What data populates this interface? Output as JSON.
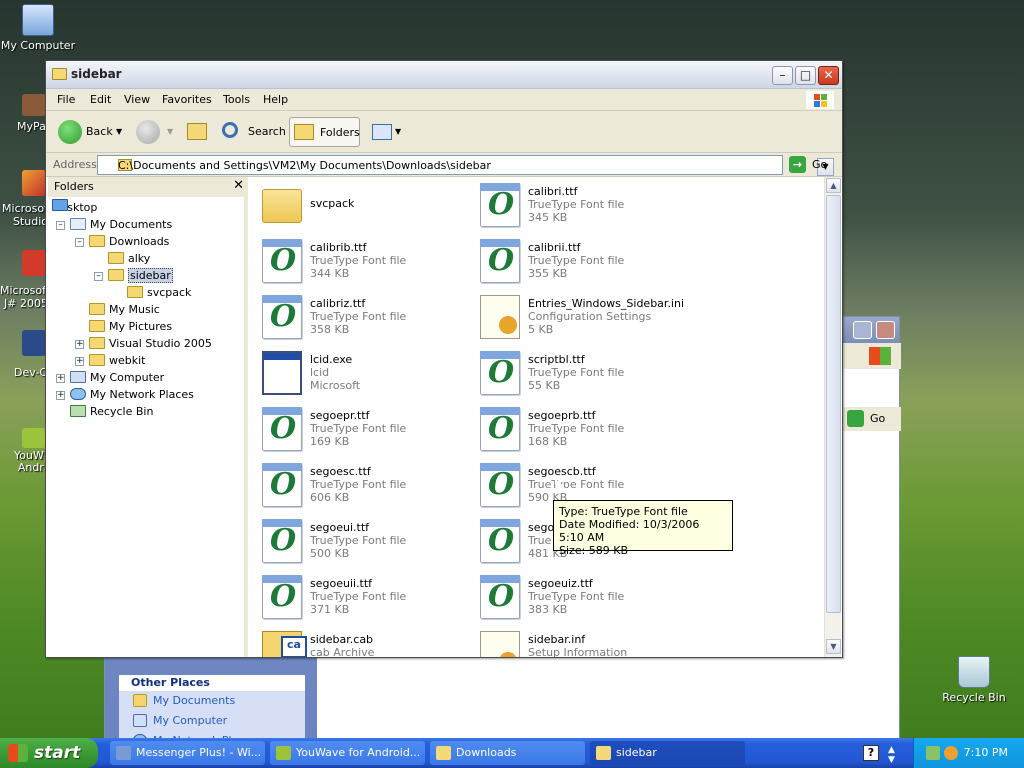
{
  "desktop": {
    "icons": [
      {
        "label": "My Computer"
      },
      {
        "label": "MyPa"
      },
      {
        "label": "Microsof\nStudio"
      },
      {
        "label": "Microsoft\nJ# 2005"
      },
      {
        "label": "Dev-C"
      },
      {
        "label": "YouW\nAndr"
      },
      {
        "label": "Recycle Bin"
      }
    ]
  },
  "back_window": {
    "other_places_title": "Other Places",
    "other_places": [
      "My Documents",
      "My Computer",
      "My Network Places"
    ],
    "go_label": "Go"
  },
  "window": {
    "title": "sidebar",
    "menu": [
      "File",
      "Edit",
      "View",
      "Favorites",
      "Tools",
      "Help"
    ],
    "toolbar": {
      "back": "Back",
      "search": "Search",
      "folders": "Folders"
    },
    "address_label": "Address",
    "address_value": "C:\\Documents and Settings\\VM2\\My Documents\\Downloads\\sidebar",
    "go_label": "Go",
    "folders_pane_title": "Folders",
    "tree": [
      {
        "label": "Desktop"
      },
      {
        "label": "My Documents"
      },
      {
        "label": "Downloads"
      },
      {
        "label": "alky"
      },
      {
        "label": "sidebar"
      },
      {
        "label": "svcpack"
      },
      {
        "label": "My Music"
      },
      {
        "label": "My Pictures"
      },
      {
        "label": "Visual Studio 2005"
      },
      {
        "label": "webkit"
      },
      {
        "label": "My Computer"
      },
      {
        "label": "My Network Places"
      },
      {
        "label": "Recycle Bin"
      }
    ],
    "files": [
      {
        "name": "svcpack",
        "type": "",
        "size": "",
        "icon": "folder-icon"
      },
      {
        "name": "calibri.ttf",
        "type": "TrueType Font file",
        "size": "345 KB",
        "icon": "font-file-icon"
      },
      {
        "name": "calibrib.ttf",
        "type": "TrueType Font file",
        "size": "344 KB",
        "icon": "font-file-icon"
      },
      {
        "name": "calibrii.ttf",
        "type": "TrueType Font file",
        "size": "355 KB",
        "icon": "font-file-icon"
      },
      {
        "name": "calibriz.ttf",
        "type": "TrueType Font file",
        "size": "358 KB",
        "icon": "font-file-icon"
      },
      {
        "name": "Entries_Windows_Sidebar.ini",
        "type": "Configuration Settings",
        "size": "5 KB",
        "icon": "ini-file-icon"
      },
      {
        "name": "lcid.exe",
        "type": "lcid",
        "size": "Microsoft",
        "icon": "exe-file-icon"
      },
      {
        "name": "scriptbl.ttf",
        "type": "TrueType Font file",
        "size": "55 KB",
        "icon": "font-file-icon"
      },
      {
        "name": "segoepr.ttf",
        "type": "TrueType Font file",
        "size": "169 KB",
        "icon": "font-file-icon"
      },
      {
        "name": "segoeprb.ttf",
        "type": "TrueType Font file",
        "size": "168 KB",
        "icon": "font-file-icon"
      },
      {
        "name": "segoesc.ttf",
        "type": "TrueType Font file",
        "size": "606 KB",
        "icon": "font-file-icon"
      },
      {
        "name": "segoescb.ttf",
        "type": "TrueType Font file",
        "size": "590 KB",
        "icon": "font-file-icon"
      },
      {
        "name": "segoeui.ttf",
        "type": "TrueType Font file",
        "size": "500 KB",
        "icon": "font-file-icon"
      },
      {
        "name": "segoe",
        "type": "True",
        "size": "481 KB",
        "icon": "font-file-icon"
      },
      {
        "name": "segoeuii.ttf",
        "type": "TrueType Font file",
        "size": "371 KB",
        "icon": "font-file-icon"
      },
      {
        "name": "segoeuiz.ttf",
        "type": "TrueType Font file",
        "size": "383 KB",
        "icon": "font-file-icon"
      },
      {
        "name": "sidebar.cab",
        "type": "cab Archive",
        "size": "",
        "icon": "cab-file-icon"
      },
      {
        "name": "sidebar.inf",
        "type": "Setup Information",
        "size": "",
        "icon": "ini-file-icon"
      }
    ],
    "tooltip": {
      "line1": "Type: TrueType Font file",
      "line2": "Date Modified: 10/3/2006 5:10 AM",
      "line3": "Size: 589 KB"
    }
  },
  "taskbar": {
    "start_label": "start",
    "tasks": [
      {
        "label": "Messenger Plus! - Wi..."
      },
      {
        "label": "YouWave for Android..."
      },
      {
        "label": "Downloads"
      },
      {
        "label": "sidebar"
      }
    ],
    "clock": "7:10 PM"
  }
}
